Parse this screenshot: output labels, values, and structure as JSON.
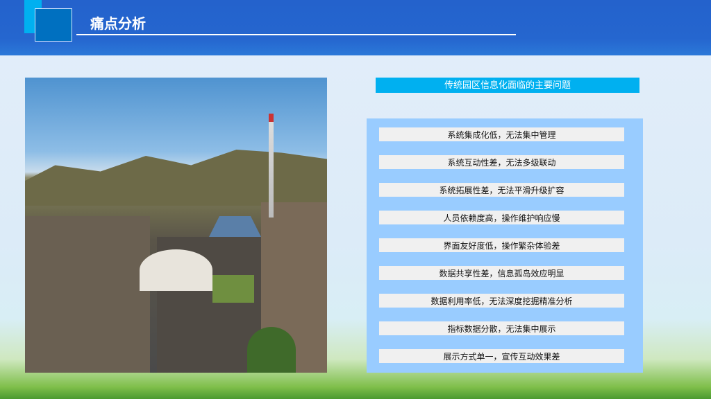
{
  "header": {
    "title": "痛点分析"
  },
  "main": {
    "photo_alt": "工业园区航拍",
    "heading": "传统园区信息化面临的主要问题",
    "items": [
      "系统集成化低，无法集中管理",
      "系统互动性差，无法多级联动",
      "系统拓展性差，无法平滑升级扩容",
      "人员依赖度高，操作维护响应慢",
      "界面友好度低，操作繁杂体验差",
      "数据共享性差，信息孤岛效应明显",
      "数据利用率低，无法深度挖掘精准分析",
      "指标数据分散，无法集中展示",
      "展示方式单一，宣传互动效果差"
    ]
  }
}
